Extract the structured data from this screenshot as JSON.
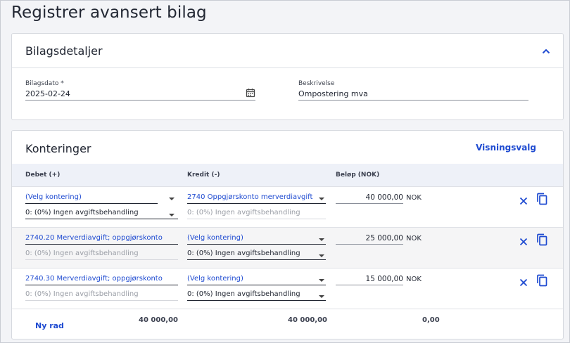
{
  "page": {
    "title": "Registrer avansert bilag"
  },
  "details": {
    "title": "Bilagsdetaljer",
    "date_label": "Bilagsdato *",
    "date_value": "2025-02-24",
    "desc_label": "Beskrivelse",
    "desc_value": "Ompostering mva"
  },
  "konteringer": {
    "title": "Konteringer",
    "view_button": "Visningsvalg",
    "headers": {
      "debet": "Debet (+)",
      "kredit": "Kredit (-)",
      "belop": "Beløp (NOK)"
    },
    "rows": [
      {
        "debet_account": "(Velg kontering)",
        "debet_vat": "0: (0%) Ingen avgiftsbehandling",
        "kredit_account": "2740 Oppgjørskonto merverdiavgift",
        "kredit_vat": "0: (0%) Ingen avgiftsbehandling",
        "amount": "40 000,00",
        "currency": "NOK"
      },
      {
        "debet_account": "2740.20 Merverdiavgift; oppgjørskonto",
        "debet_vat": "0: (0%) Ingen avgiftsbehandling",
        "kredit_account": "(Velg kontering)",
        "kredit_vat": "0: (0%) Ingen avgiftsbehandling",
        "amount": "25 000,00",
        "currency": "NOK"
      },
      {
        "debet_account": "2740.30 Merverdiavgift; oppgjørskonto",
        "debet_vat": "0: (0%) Ingen avgiftsbehandling",
        "kredit_account": "(Velg kontering)",
        "kredit_vat": "0: (0%) Ingen avgiftsbehandling",
        "amount": "15 000,00",
        "currency": "NOK"
      }
    ],
    "add_row": "Ny rad",
    "totals": {
      "debet": "40 000,00",
      "kredit": "40 000,00",
      "diff": "0,00"
    }
  },
  "colors": {
    "accent": "#1f4bd1",
    "header_bg": "#eef1f8",
    "page_bg": "#f3f4f7"
  },
  "icons": [
    "chevron-up-icon",
    "calendar-icon",
    "close-icon",
    "copy-icon",
    "caret-down-icon"
  ]
}
